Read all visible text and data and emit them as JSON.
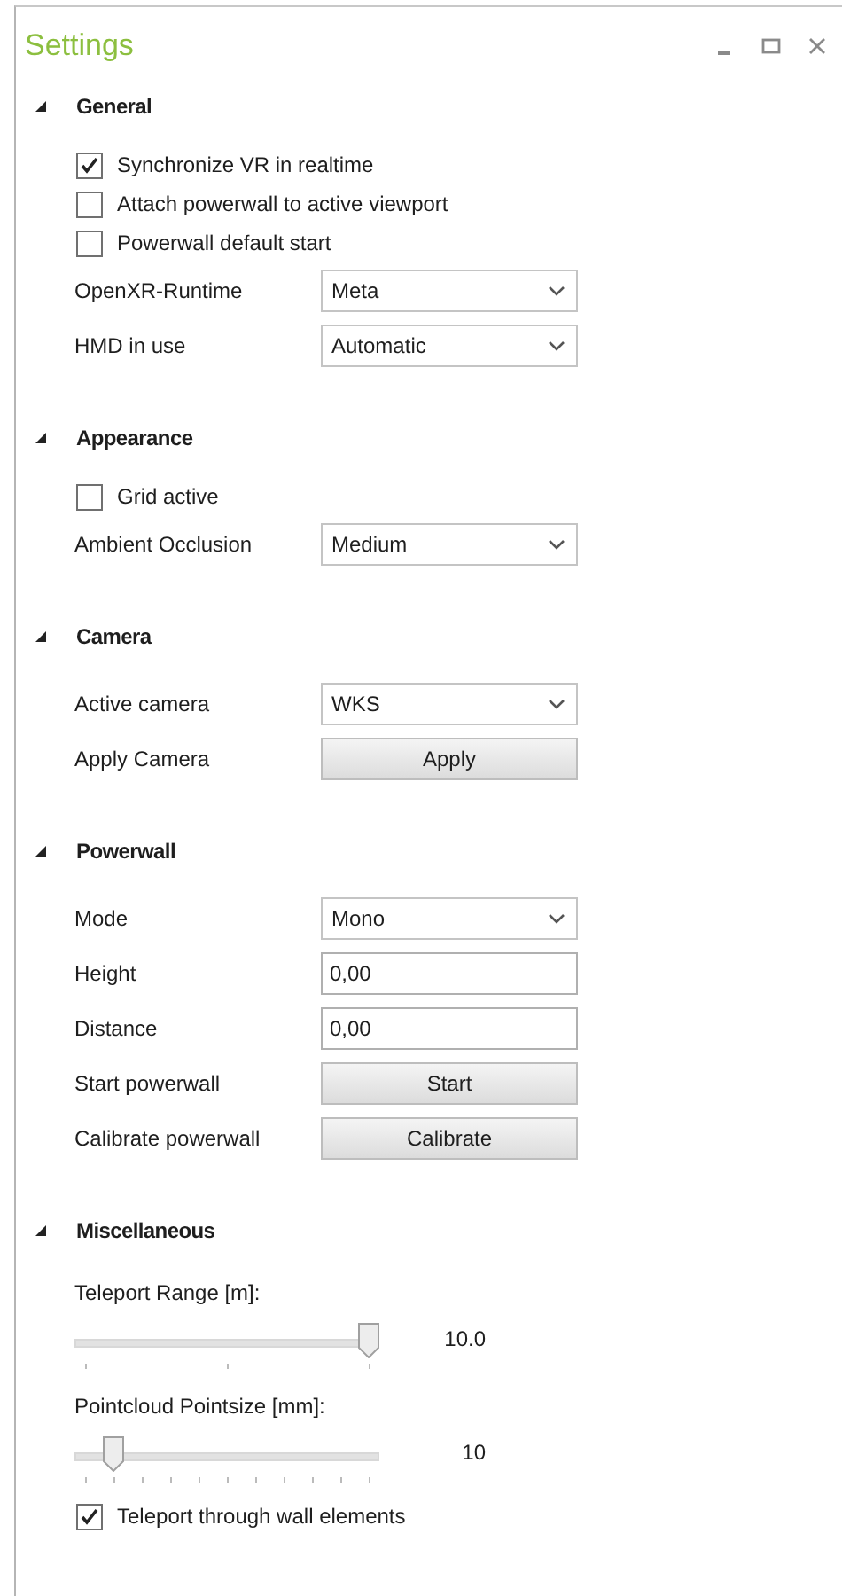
{
  "window": {
    "title": "Settings"
  },
  "sections": [
    {
      "title": "General",
      "expanded": true,
      "rows": [
        {
          "kind": "checkbox",
          "label": "Synchronize VR in realtime",
          "checked": true
        },
        {
          "kind": "checkbox",
          "label": "Attach powerwall to active viewport",
          "checked": false
        },
        {
          "kind": "checkbox",
          "label": "Powerwall default start",
          "checked": false
        },
        {
          "kind": "dropdown",
          "label": "OpenXR-Runtime",
          "value": "Meta"
        },
        {
          "kind": "dropdown",
          "label": "HMD in use",
          "value": "Automatic"
        }
      ]
    },
    {
      "title": "Appearance",
      "expanded": true,
      "rows": [
        {
          "kind": "checkbox",
          "label": "Grid active",
          "checked": false
        },
        {
          "kind": "dropdown",
          "label": "Ambient Occlusion",
          "value": "Medium"
        }
      ]
    },
    {
      "title": "Camera",
      "expanded": true,
      "rows": [
        {
          "kind": "dropdown",
          "label": "Active camera",
          "value": "WKS"
        },
        {
          "kind": "button",
          "label": "Apply Camera",
          "value": "Apply"
        }
      ]
    },
    {
      "title": "Powerwall",
      "expanded": true,
      "rows": [
        {
          "kind": "dropdown",
          "label": "Mode",
          "value": "Mono"
        },
        {
          "kind": "textbox",
          "label": "Height",
          "value": "0,00"
        },
        {
          "kind": "textbox",
          "label": "Distance",
          "value": "0,00"
        },
        {
          "kind": "button",
          "label": "Start powerwall",
          "value": "Start"
        },
        {
          "kind": "button",
          "label": "Calibrate powerwall",
          "value": "Calibrate"
        }
      ]
    },
    {
      "title": "Miscellaneous",
      "expanded": true,
      "rows": [
        {
          "kind": "slider",
          "label": "Teleport Range [m]:",
          "level": 1.0,
          "reading": "10.0"
        },
        {
          "kind": "slider",
          "label": "Pointcloud Pointsize [mm]:",
          "level": 0.1,
          "reading": "10"
        },
        {
          "kind": "checkbox",
          "label": "Teleport through wall elements",
          "checked": true
        }
      ]
    }
  ]
}
